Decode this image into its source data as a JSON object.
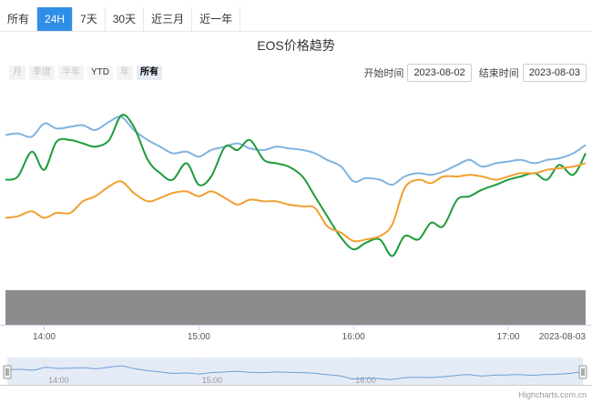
{
  "tabs": [
    "所有",
    "24H",
    "7天",
    "30天",
    "近三月",
    "近一年"
  ],
  "active_tab": "24H",
  "title": "EOS价格趋势",
  "range_buttons": [
    "月",
    "季度",
    "半年",
    "YTD",
    "年",
    "所有"
  ],
  "range_enabled": [
    "YTD",
    "所有"
  ],
  "range_selected": "所有",
  "date_range": {
    "start_label": "开始时间",
    "start_value": "2023-08-02",
    "end_label": "结束时间",
    "end_value": "2023-08-03"
  },
  "credits": "Highcharts.com.cn",
  "colors": {
    "tab_active": "#2f8fe6",
    "series_light_blue": "#7fb3e0",
    "series_green": "#1e9b3c",
    "series_orange": "#f0a030",
    "volume_band": "#8c8c8c",
    "navigator_fill": "#d4def0"
  },
  "chart_data": {
    "type": "line",
    "title": "EOS价格趋势",
    "x_tick_labels": [
      "14:00",
      "15:00",
      "16:00",
      "17:00",
      "2023-08-03"
    ],
    "navigator_tick_labels": [
      "14:00",
      "15:00",
      "16:00"
    ],
    "x_range": [
      13.75,
      17.5
    ],
    "y_range": [
      0,
      100
    ],
    "grid": true,
    "legend": "none",
    "series": [
      {
        "color": "#7fb3e0",
        "x": [
          13.75,
          13.83,
          13.92,
          14.0,
          14.08,
          14.17,
          14.25,
          14.33,
          14.42,
          14.5,
          14.58,
          14.67,
          14.75,
          14.83,
          14.92,
          15.0,
          15.08,
          15.17,
          15.25,
          15.33,
          15.42,
          15.5,
          15.58,
          15.67,
          15.75,
          15.83,
          15.92,
          16.0,
          16.08,
          16.17,
          16.25,
          16.33,
          16.42,
          16.5,
          16.58,
          16.67,
          16.75,
          16.83,
          16.92,
          17.0,
          17.08,
          17.17,
          17.25,
          17.33,
          17.42,
          17.5
        ],
        "y": [
          75,
          76,
          74,
          82,
          79,
          80,
          81,
          78,
          83,
          86,
          78,
          72,
          68,
          64,
          65,
          62,
          66,
          68,
          70,
          67,
          66,
          68,
          67,
          66,
          64,
          60,
          56,
          47,
          49,
          48,
          45,
          50,
          52,
          51,
          53,
          57,
          60,
          56,
          58,
          59,
          60,
          58,
          60,
          61,
          64,
          69
        ]
      },
      {
        "color": "#1e9b3c",
        "x": [
          13.75,
          13.83,
          13.92,
          14.0,
          14.08,
          14.17,
          14.25,
          14.33,
          14.42,
          14.5,
          14.58,
          14.67,
          14.75,
          14.83,
          14.92,
          15.0,
          15.08,
          15.17,
          15.25,
          15.33,
          15.42,
          15.5,
          15.58,
          15.67,
          15.75,
          15.83,
          15.92,
          16.0,
          16.08,
          16.17,
          16.25,
          16.33,
          16.42,
          16.5,
          16.58,
          16.67,
          16.75,
          16.83,
          16.92,
          17.0,
          17.08,
          17.17,
          17.25,
          17.33,
          17.42,
          17.5
        ],
        "y": [
          48,
          50,
          65,
          54,
          71,
          72,
          70,
          68,
          72,
          87,
          80,
          60,
          52,
          48,
          58,
          45,
          50,
          68,
          66,
          72,
          60,
          58,
          56,
          50,
          38,
          26,
          13,
          6,
          10,
          12,
          2,
          14,
          12,
          22,
          20,
          36,
          38,
          42,
          45,
          48,
          50,
          52,
          48,
          57,
          51,
          64
        ]
      },
      {
        "color": "#f0a030",
        "x": [
          13.75,
          13.83,
          13.92,
          14.0,
          14.08,
          14.17,
          14.25,
          14.33,
          14.42,
          14.5,
          14.58,
          14.67,
          14.75,
          14.83,
          14.92,
          15.0,
          15.08,
          15.17,
          15.25,
          15.33,
          15.42,
          15.5,
          15.58,
          15.67,
          15.75,
          15.83,
          15.92,
          16.0,
          16.08,
          16.17,
          16.25,
          16.33,
          16.42,
          16.5,
          16.58,
          16.67,
          16.75,
          16.83,
          16.92,
          17.0,
          17.08,
          17.17,
          17.25,
          17.33,
          17.42,
          17.5
        ],
        "y": [
          25,
          26,
          29,
          25,
          28,
          28,
          35,
          38,
          44,
          47,
          40,
          35,
          37,
          40,
          41,
          38,
          41,
          37,
          33,
          36,
          35,
          35,
          33,
          32,
          31,
          20,
          16,
          11,
          12,
          14,
          21,
          43,
          48,
          46,
          50,
          50,
          51,
          50,
          48,
          50,
          52,
          52,
          54,
          55,
          56,
          58
        ]
      }
    ]
  }
}
